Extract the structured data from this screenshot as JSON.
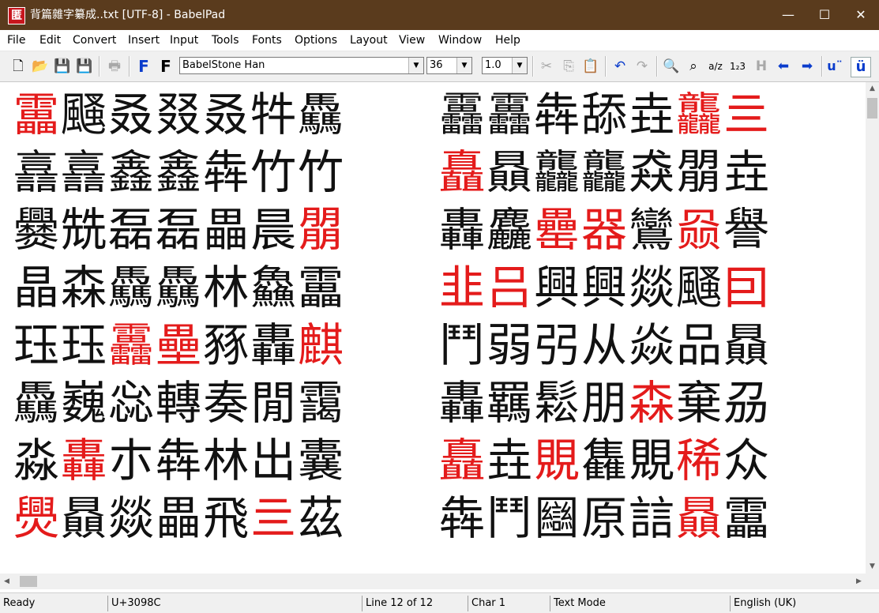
{
  "window": {
    "title": "背篇雜字纂成..txt [UTF-8] - BabelPad",
    "icon_glyph": "匿",
    "minimize": "—",
    "maximize": "☐",
    "close": "✕"
  },
  "menu": [
    "File",
    "Edit",
    "Convert",
    "Insert",
    "Input",
    "Tools",
    "Fonts",
    "Options",
    "Layout",
    "View",
    "Window",
    "Help"
  ],
  "toolbar": {
    "font_name": "BabelStone Han",
    "font_size": "36",
    "line_spacing": "1.0",
    "icons": {
      "new": "🗋",
      "open": "📂",
      "save": "💾",
      "save_all": "💾",
      "print": "🖶",
      "font_blue": "F",
      "font_black": "F",
      "cut": "✂",
      "copy": "⎘",
      "paste": "📋",
      "undo": "↶",
      "redo": "↷",
      "find": "🔍",
      "replace": "⌕",
      "sort": "a/z",
      "number": "1₂3",
      "hint": "H",
      "prev": "⬅",
      "next": "➡",
      "u_diaeresis_sep": "u¨",
      "u_diaeresis": "ü"
    }
  },
  "editor": {
    "left_column": [
      [
        {
          "t": "靁",
          "r": true
        },
        {
          "t": "颾"
        },
        {
          "t": "叒"
        },
        {
          "t": "叕"
        },
        {
          "t": "叒"
        },
        {
          "t": "牪"
        },
        {
          "t": "驫"
        }
      ],
      [
        {
          "t": "譶"
        },
        {
          "t": "譶"
        },
        {
          "t": "鑫"
        },
        {
          "t": "鑫"
        },
        {
          "t": "犇"
        },
        {
          "t": "竹"
        },
        {
          "t": "竹"
        }
      ],
      [
        {
          "t": "爨"
        },
        {
          "t": "兟"
        },
        {
          "t": "磊"
        },
        {
          "t": "磊"
        },
        {
          "t": "畾"
        },
        {
          "t": "晨"
        },
        {
          "t": "朤",
          "r": true
        }
      ],
      [
        {
          "t": "晶"
        },
        {
          "t": "森"
        },
        {
          "t": "驫"
        },
        {
          "t": "驫"
        },
        {
          "t": "林"
        },
        {
          "t": "鱻"
        },
        {
          "t": "靁"
        }
      ],
      [
        {
          "t": "珏"
        },
        {
          "t": "珏"
        },
        {
          "t": "靐",
          "r": true
        },
        {
          "t": "壘",
          "r": true
        },
        {
          "t": "豩"
        },
        {
          "t": "轟"
        },
        {
          "t": "麒",
          "r": true
        }
      ],
      [
        {
          "t": "驫"
        },
        {
          "t": "巍"
        },
        {
          "t": "惢"
        },
        {
          "t": "轉"
        },
        {
          "t": "奏"
        },
        {
          "t": "閒"
        },
        {
          "t": "靄"
        }
      ],
      [
        {
          "t": "淼"
        },
        {
          "t": "轟",
          "r": true
        },
        {
          "t": "朩"
        },
        {
          "t": "犇"
        },
        {
          "t": "林"
        },
        {
          "t": "出"
        },
        {
          "t": "囊"
        }
      ],
      [
        {
          "t": "爂",
          "r": true
        },
        {
          "t": "贔"
        },
        {
          "t": "燚"
        },
        {
          "t": "畾"
        },
        {
          "t": "飛"
        },
        {
          "t": "亖",
          "r": true
        },
        {
          "t": "茲"
        }
      ]
    ],
    "right_column": [
      [
        {
          "t": "靐"
        },
        {
          "t": "靐"
        },
        {
          "t": "犇"
        },
        {
          "t": "舔"
        },
        {
          "t": "垚"
        },
        {
          "t": "龘",
          "r": true
        },
        {
          "t": "亖",
          "r": true
        }
      ],
      [
        {
          "t": "矗",
          "r": true
        },
        {
          "t": "贔"
        },
        {
          "t": "龘"
        },
        {
          "t": "龘"
        },
        {
          "t": "猋"
        },
        {
          "t": "朤"
        },
        {
          "t": "垚"
        }
      ],
      [
        {
          "t": "轟"
        },
        {
          "t": "麤"
        },
        {
          "t": "罍",
          "r": true
        },
        {
          "t": "器",
          "r": true
        },
        {
          "t": "鸞"
        },
        {
          "t": "赑",
          "r": true
        },
        {
          "t": "譽"
        }
      ],
      [
        {
          "t": "韭",
          "r": true
        },
        {
          "t": "吕",
          "r": true
        },
        {
          "t": "興"
        },
        {
          "t": "興"
        },
        {
          "t": "燚"
        },
        {
          "t": "颾"
        },
        {
          "t": "囙",
          "r": true
        }
      ],
      [
        {
          "t": "鬥"
        },
        {
          "t": "弱"
        },
        {
          "t": "弜"
        },
        {
          "t": "从"
        },
        {
          "t": "焱"
        },
        {
          "t": "品"
        },
        {
          "t": "贔"
        }
      ],
      [
        {
          "t": "轟"
        },
        {
          "t": "羈"
        },
        {
          "t": "鬆"
        },
        {
          "t": "朋"
        },
        {
          "t": "森",
          "r": true
        },
        {
          "t": "棄"
        },
        {
          "t": "刕"
        }
      ],
      [
        {
          "t": "矗",
          "r": true
        },
        {
          "t": "垚"
        },
        {
          "t": "覞",
          "r": true
        },
        {
          "t": "雥"
        },
        {
          "t": "覞"
        },
        {
          "t": "稀",
          "r": true
        },
        {
          "t": "众"
        }
      ],
      [
        {
          "t": "犇"
        },
        {
          "t": "鬥"
        },
        {
          "t": "圝"
        },
        {
          "t": "原"
        },
        {
          "t": "誩"
        },
        {
          "t": "贔",
          "r": true
        },
        {
          "t": "靁"
        }
      ]
    ]
  },
  "statusbar": {
    "state": "Ready",
    "codepoint": "U+3098C",
    "line": "Line 12 of 12",
    "char": "Char 1",
    "mode": "Text Mode",
    "language": "English (UK)"
  }
}
